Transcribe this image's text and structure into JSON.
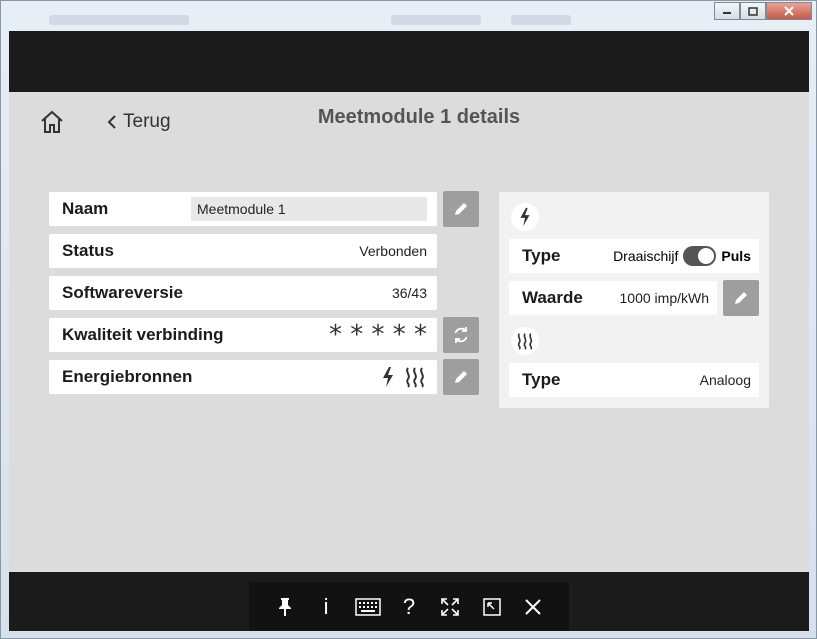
{
  "header": {
    "back_label": "Terug",
    "title": "Meetmodule 1 details"
  },
  "module": {
    "name_label": "Naam",
    "name_value": "Meetmodule 1",
    "status_label": "Status",
    "status_value": "Verbonden",
    "software_label": "Softwareversie",
    "software_value": "36/43",
    "quality_label": "Kwaliteit verbinding",
    "quality_stars": "* * * * *",
    "sources_label": "Energiebronnen"
  },
  "electricity": {
    "icon": "lightning-icon",
    "type_label": "Type",
    "type_option_left": "Draaischijf",
    "type_option_right": "Puls",
    "toggle_on": true,
    "value_label": "Waarde",
    "value_value": "1000 imp/kWh"
  },
  "heat": {
    "icon": "heat-waves-icon",
    "type_label": "Type",
    "type_value": "Analoog"
  },
  "toolbar": {
    "icons": [
      "pin-icon",
      "info-icon",
      "keyboard-icon",
      "help-icon",
      "fullscreen-icon",
      "window-icon",
      "close-icon"
    ],
    "info_glyph": "i",
    "help_glyph": "?"
  },
  "colors": {
    "bar": "#1b1b1b",
    "background": "#dcdcdc",
    "button": "#9e9e9e",
    "panel": "#f2f2f2"
  }
}
